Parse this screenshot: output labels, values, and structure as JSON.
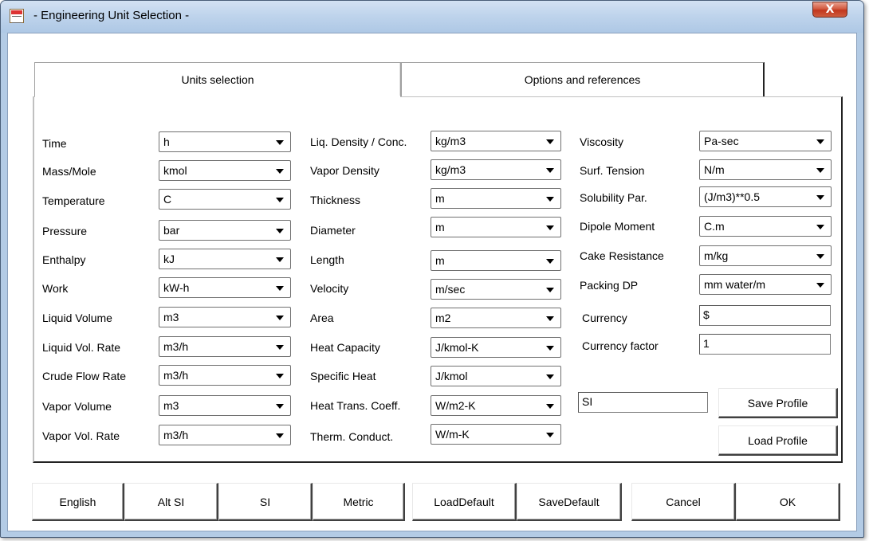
{
  "window": {
    "title": "- Engineering Unit Selection -",
    "close_label": "X"
  },
  "tabs": [
    {
      "label": "Units selection"
    },
    {
      "label": "Options and references"
    }
  ],
  "units": {
    "time": {
      "label": "Time",
      "value": "h"
    },
    "mass_mole": {
      "label": "Mass/Mole",
      "value": "kmol"
    },
    "temperature": {
      "label": "Temperature",
      "value": "C"
    },
    "pressure": {
      "label": "Pressure",
      "value": "bar"
    },
    "enthalpy": {
      "label": "Enthalpy",
      "value": "kJ"
    },
    "work": {
      "label": "Work",
      "value": "kW-h"
    },
    "liquid_volume": {
      "label": "Liquid Volume",
      "value": "m3"
    },
    "liquid_vol_rate": {
      "label": "Liquid Vol. Rate",
      "value": "m3/h"
    },
    "crude_flow_rate": {
      "label": "Crude Flow Rate",
      "value": "m3/h"
    },
    "vapor_volume": {
      "label": "Vapor Volume",
      "value": "m3"
    },
    "vapor_vol_rate": {
      "label": "Vapor Vol. Rate",
      "value": "m3/h"
    },
    "liq_density_conc": {
      "label": "Liq. Density / Conc.",
      "value": "kg/m3"
    },
    "vapor_density": {
      "label": "Vapor Density",
      "value": "kg/m3"
    },
    "thickness": {
      "label": "Thickness",
      "value": "m"
    },
    "diameter": {
      "label": "Diameter",
      "value": "m"
    },
    "length": {
      "label": "Length",
      "value": "m"
    },
    "velocity": {
      "label": "Velocity",
      "value": "m/sec"
    },
    "area": {
      "label": "Area",
      "value": "m2"
    },
    "heat_capacity": {
      "label": "Heat Capacity",
      "value": "J/kmol-K"
    },
    "specific_heat": {
      "label": "Specific Heat",
      "value": "J/kmol"
    },
    "heat_trans_coeff": {
      "label": "Heat Trans. Coeff.",
      "value": "W/m2-K"
    },
    "therm_conduct": {
      "label": "Therm. Conduct.",
      "value": "W/m-K"
    },
    "viscosity": {
      "label": "Viscosity",
      "value": "Pa-sec"
    },
    "surf_tension": {
      "label": "Surf. Tension",
      "value": "N/m"
    },
    "solubility_par": {
      "label": "Solubility Par.",
      "value": "(J/m3)**0.5"
    },
    "dipole_moment": {
      "label": "Dipole Moment",
      "value": "C.m"
    },
    "cake_resistance": {
      "label": "Cake Resistance",
      "value": "m/kg"
    },
    "packing_dp": {
      "label": "Packing DP",
      "value": "mm water/m"
    }
  },
  "currency": {
    "label": "Currency",
    "value": "$"
  },
  "currency_factor": {
    "label": "Currency factor",
    "value": "1"
  },
  "profile": {
    "name": "SI",
    "save_label": "Save Profile",
    "load_label": "Load Profile"
  },
  "footer_buttons": {
    "english": "English",
    "alt_si": "Alt SI",
    "si": "SI",
    "metric": "Metric",
    "load_default": "LoadDefault",
    "save_default": "SaveDefault",
    "cancel": "Cancel",
    "ok": "OK"
  }
}
